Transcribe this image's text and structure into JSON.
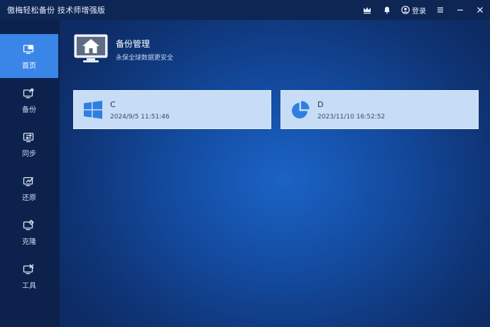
{
  "app": {
    "title": "傲梅轻松备份 技术师增强版"
  },
  "titlebar": {
    "login_label": "登录"
  },
  "sidebar": {
    "items": [
      {
        "label": "首页",
        "icon": "home-icon",
        "active": true
      },
      {
        "label": "备份",
        "icon": "backup-icon",
        "active": false
      },
      {
        "label": "同步",
        "icon": "sync-icon",
        "active": false
      },
      {
        "label": "还原",
        "icon": "restore-icon",
        "active": false
      },
      {
        "label": "克隆",
        "icon": "clone-icon",
        "active": false
      },
      {
        "label": "工具",
        "icon": "tools-icon",
        "active": false
      }
    ]
  },
  "main": {
    "title": "备份管理",
    "subtitle": "永保全球数据更安全",
    "cards": [
      {
        "name": "C",
        "date": "2024/9/5 11:51:46",
        "icon": "windows-icon"
      },
      {
        "name": "D",
        "date": "2023/11/10 16:52:52",
        "icon": "partition-pie-icon"
      }
    ]
  },
  "colors": {
    "accent": "#3a86e8",
    "sidebar_bg": "#0c224c",
    "card_bg": "#c7dcf5",
    "icon_blue": "#2f7fe0"
  }
}
